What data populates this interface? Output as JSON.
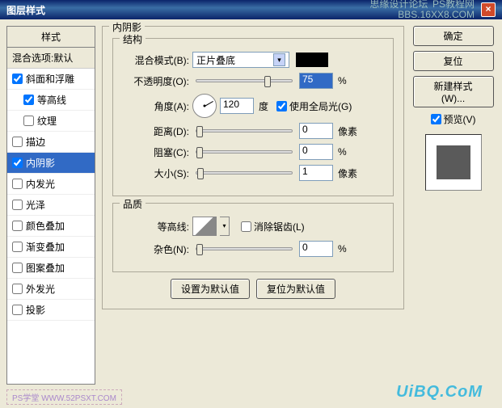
{
  "titlebar": {
    "title": "图层样式",
    "watermark1": "思缘设计论坛",
    "watermark2": "BBS.16XX8.COM",
    "watermark3": "PS教程网"
  },
  "left": {
    "header": "样式",
    "blend_defaults": "混合选项:默认",
    "items": [
      {
        "label": "斜面和浮雕",
        "checked": true
      },
      {
        "label": "等高线",
        "checked": true,
        "indent": true
      },
      {
        "label": "纹理",
        "checked": false,
        "indent": true
      },
      {
        "label": "描边",
        "checked": false
      },
      {
        "label": "内阴影",
        "checked": true,
        "selected": true
      },
      {
        "label": "内发光",
        "checked": false
      },
      {
        "label": "光泽",
        "checked": false
      },
      {
        "label": "颜色叠加",
        "checked": false
      },
      {
        "label": "渐变叠加",
        "checked": false
      },
      {
        "label": "图案叠加",
        "checked": false
      },
      {
        "label": "外发光",
        "checked": false
      },
      {
        "label": "投影",
        "checked": false
      }
    ]
  },
  "mid": {
    "group1_title": "内阴影",
    "structure_title": "结构",
    "blend_mode_label": "混合模式(B):",
    "blend_mode_value": "正片叠底",
    "opacity_label": "不透明度(O):",
    "opacity_value": "75",
    "opacity_unit": "%",
    "opacity_pct": 75,
    "angle_label": "角度(A):",
    "angle_value": "120",
    "angle_unit": "度",
    "global_light_label": "使用全局光(G)",
    "global_light_checked": true,
    "distance_label": "距离(D):",
    "distance_value": "0",
    "distance_unit": "像素",
    "distance_pct": 0,
    "choke_label": "阻塞(C):",
    "choke_value": "0",
    "choke_unit": "%",
    "choke_pct": 0,
    "size_label": "大小(S):",
    "size_value": "1",
    "size_unit": "像素",
    "size_pct": 1,
    "quality_title": "品质",
    "contour_label": "等高线:",
    "antialias_label": "消除锯齿(L)",
    "antialias_checked": false,
    "noise_label": "杂色(N):",
    "noise_value": "0",
    "noise_unit": "%",
    "noise_pct": 0,
    "default_btn": "设置为默认值",
    "reset_btn": "复位为默认值"
  },
  "right": {
    "ok": "确定",
    "cancel": "复位",
    "new_style": "新建样式(W)...",
    "preview_label": "预览(V)",
    "preview_checked": true
  },
  "footer": {
    "ps_tag": "PS学堂  WWW.52PSXT.COM",
    "uibq": "UiBQ.CoM"
  }
}
